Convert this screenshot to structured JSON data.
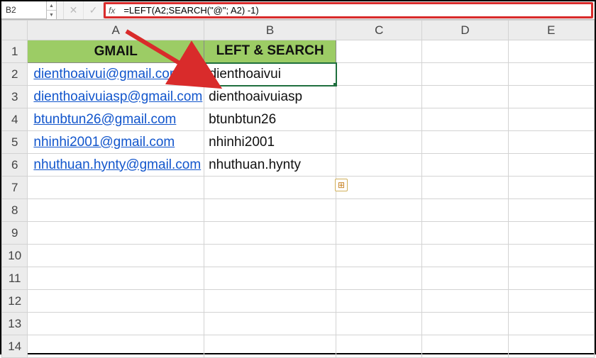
{
  "nameBox": "B2",
  "formula": "=LEFT(A2;SEARCH(\"@\"; A2) -1)",
  "fxLabel": "fx",
  "columns": [
    "A",
    "B",
    "C",
    "D",
    "E"
  ],
  "headers": {
    "A": "GMAIL",
    "B": "LEFT & SEARCH"
  },
  "rows": [
    {
      "num": "1",
      "A_header": true,
      "B_header": true
    },
    {
      "num": "2",
      "A": "dienthoaivui@gmail.com",
      "B": "dienthoaivui",
      "active": true
    },
    {
      "num": "3",
      "A": "dienthoaivuiasp@gmail.com",
      "B": "dienthoaivuiasp"
    },
    {
      "num": "4",
      "A": "btunbtun26@gmail.com",
      "B": "btunbtun26"
    },
    {
      "num": "5",
      "A": "nhinhi2001@gmail.com",
      "B": "nhinhi2001"
    },
    {
      "num": "6",
      "A": "nhuthuan.hynty@gmail.com",
      "B": "nhuthuan.hynty"
    },
    {
      "num": "7"
    },
    {
      "num": "8"
    },
    {
      "num": "9"
    },
    {
      "num": "10"
    },
    {
      "num": "11"
    },
    {
      "num": "12"
    },
    {
      "num": "13"
    },
    {
      "num": "14"
    }
  ],
  "icons": {
    "up": "▲",
    "down": "▼",
    "cancel": "✕",
    "check": "✓",
    "autofill": "⊞"
  },
  "colors": {
    "highlight": "#d92b2b",
    "header": "#9ccc65",
    "selection": "#1f6f3e"
  }
}
